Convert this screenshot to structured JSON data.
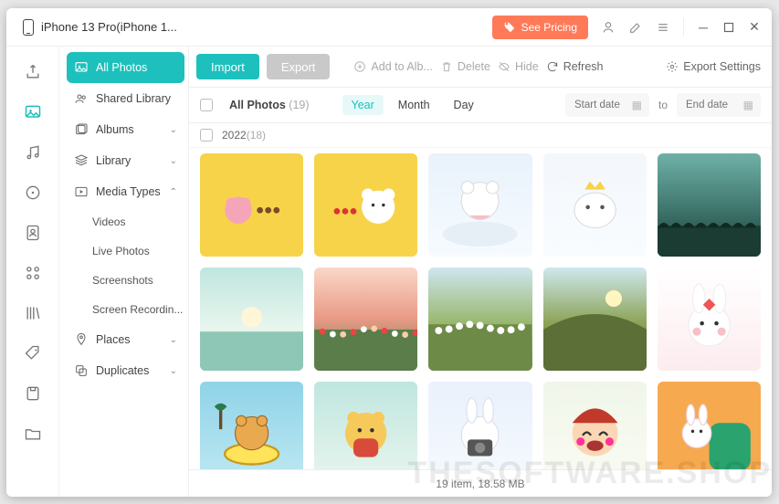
{
  "titlebar": {
    "device": "iPhone 13 Pro(iPhone 1...",
    "pricing": "See Pricing"
  },
  "rail": [
    {
      "name": "export-icon"
    },
    {
      "name": "photos-icon",
      "active": true
    },
    {
      "name": "music-icon"
    },
    {
      "name": "disc-icon"
    },
    {
      "name": "contacts-icon"
    },
    {
      "name": "apps-icon"
    },
    {
      "name": "books-icon"
    },
    {
      "name": "tags-icon"
    },
    {
      "name": "box-icon"
    },
    {
      "name": "folder-icon"
    }
  ],
  "sidebar": {
    "all_photos": "All Photos",
    "shared_library": "Shared Library",
    "albums": "Albums",
    "library": "Library",
    "media_types": "Media Types",
    "media_sub": [
      "Videos",
      "Live Photos",
      "Screenshots",
      "Screen Recordin..."
    ],
    "places": "Places",
    "duplicates": "Duplicates"
  },
  "toolbar": {
    "import": "Import",
    "export": "Export",
    "add_to_album": "Add to Alb...",
    "delete": "Delete",
    "hide": "Hide",
    "refresh": "Refresh",
    "export_settings": "Export Settings"
  },
  "filter": {
    "all_photos": "All Photos",
    "count": "(19)",
    "seg": [
      "Year",
      "Month",
      "Day"
    ],
    "seg_active": 0,
    "start_placeholder": "Start date",
    "to": "to",
    "end_placeholder": "End date"
  },
  "group": {
    "year": "2022",
    "count": "(18)"
  },
  "thumbs": [
    {
      "bg": "linear-gradient(#f7d34a,#f7d34a)",
      "deco": "pink-blob"
    },
    {
      "bg": "linear-gradient(#f7d34a,#f7d34a)",
      "deco": "bear-hearts"
    },
    {
      "bg": "linear-gradient(#e9f2fb,#f6fbff)",
      "deco": "cloud-bear"
    },
    {
      "bg": "linear-gradient(#f3f7fb,#f9fcff)",
      "deco": "crown-blob"
    },
    {
      "bg": "linear-gradient(#6fb1a7,#3a6f66 60%,#1b3c33)",
      "deco": "tree-line"
    },
    {
      "bg": "linear-gradient(#bfe6df,#e9f6ee 60%,#8fc7b6)",
      "deco": "sunset"
    },
    {
      "bg": "linear-gradient(#fbd6c8,#e89a86 50%,#5a7d4a)",
      "deco": "flowers-orange"
    },
    {
      "bg": "linear-gradient(#cfe6ef,#98b66c 55%,#6e8a47)",
      "deco": "flowers-blue"
    },
    {
      "bg": "linear-gradient(#cfe8ee,#8aa253 55%,#5c6f36)",
      "deco": "hill-sun"
    },
    {
      "bg": "linear-gradient(#fff,#fdecef)",
      "deco": "bunny-bow"
    },
    {
      "bg": "linear-gradient(#8fd3e8,#bfe9f2)",
      "deco": "swim-bear"
    },
    {
      "bg": "linear-gradient(#bfe6df,#e9f6ee)",
      "deco": "pooh"
    },
    {
      "bg": "linear-gradient(#eaf1fb,#f6faff)",
      "deco": "camera-bunny"
    },
    {
      "bg": "linear-gradient(#f1f6ea,#f8fbf2)",
      "deco": "girl-laugh"
    },
    {
      "bg": "linear-gradient(#f6a94f,#f6a94f)",
      "deco": "bunny-chair"
    }
  ],
  "status": "19 item, 18.58 MB",
  "watermark": "THESOFTWARE.SHOP"
}
